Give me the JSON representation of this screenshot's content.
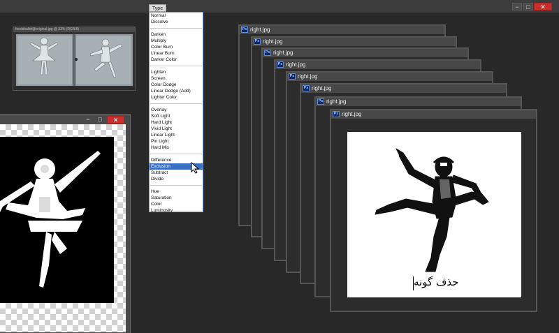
{
  "app": {
    "window_controls": {
      "minimize": "−",
      "maximize": "□",
      "close": "✕"
    }
  },
  "blend_menu": {
    "tab_label": "Type",
    "groups": [
      [
        "Normal",
        "Dissolve"
      ],
      [
        "Darken",
        "Multiply",
        "Color Burn",
        "Linear Burn",
        "Darker Color"
      ],
      [
        "Lighten",
        "Screen",
        "Color Dodge",
        "Linear Dodge (Add)",
        "Lighter Color"
      ],
      [
        "Overlay",
        "Soft Light",
        "Hard Light",
        "Vivid Light",
        "Linear Light",
        "Pin Light",
        "Hard Mix"
      ],
      [
        "Difference",
        "Exclusion",
        "Subtract",
        "Divide"
      ],
      [
        "Hue",
        "Saturation",
        "Color",
        "Luminosity"
      ]
    ],
    "selected": "Exclusion"
  },
  "thumbnail_window": {
    "title": "foodsballet@original.jpg @ 33% (RGB/8)"
  },
  "mask_window": {
    "controls": {
      "minimize": "−",
      "maximize": "□",
      "close": "✕"
    }
  },
  "documents": [
    {
      "name": "right.jpg"
    },
    {
      "name": "right.jpg"
    },
    {
      "name": "right.jpg"
    },
    {
      "name": "right.jpg"
    },
    {
      "name": "right.jpg"
    },
    {
      "name": "right.jpg"
    },
    {
      "name": "right.jpg"
    },
    {
      "name": "right.jpg"
    }
  ],
  "front_document": {
    "canvas_text": "حذف گونه"
  },
  "icons": {
    "doc_icon": "photoshop-icon",
    "cursor": "arrow-cursor-icon"
  },
  "colors": {
    "workspace": "#282828",
    "menu_highlight": "#3a6fc1",
    "close_button": "#c9302c"
  }
}
